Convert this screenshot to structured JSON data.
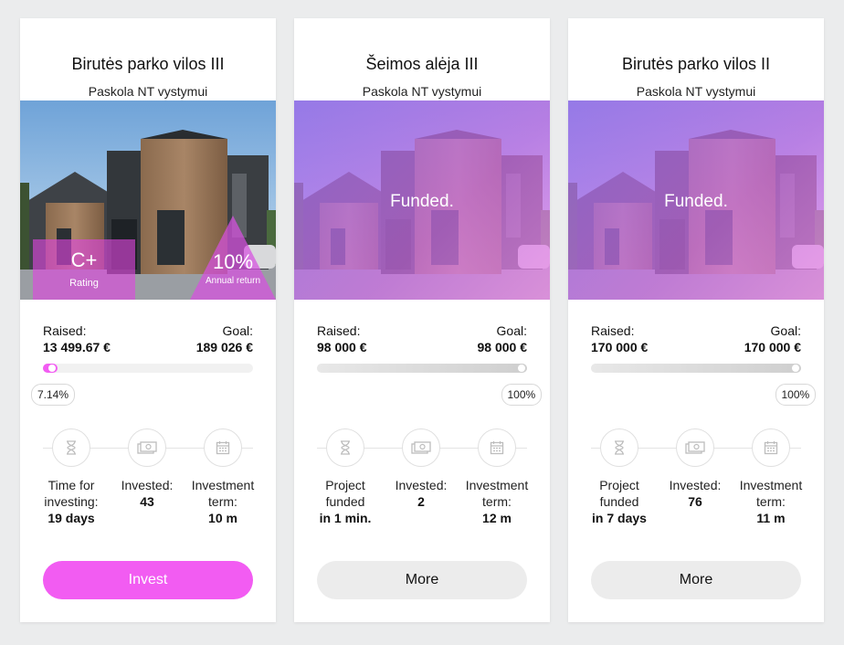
{
  "colors": {
    "accent": "#f25cf2",
    "funded_overlay": "#b97ae8",
    "button_grey": "#ececec",
    "page_bg": "#ebeced"
  },
  "cards": [
    {
      "title": "Birutės parko vilos III",
      "subtitle": "Paskola NT vystymui",
      "rating_value": "C+",
      "rating_label": "Rating",
      "return_value": "10%",
      "return_label": "Annual return",
      "raised_label": "Raised:",
      "raised_value": "13 499.67 €",
      "goal_label": "Goal:",
      "goal_value": "189 026 €",
      "progress_percent": 7.14,
      "progress_label": "7.14%",
      "stat1_line1": "Time for",
      "stat1_line2": "investing:",
      "stat1_value": "19 days",
      "stat2_label": "Invested:",
      "stat2_value": "43",
      "stat3_line1": "Investment",
      "stat3_line2": "term:",
      "stat3_value": "10 m",
      "button_label": "Invest"
    },
    {
      "title": "Šeimos alėja III",
      "subtitle": "Paskola NT vystymui",
      "funded_text": "Funded.",
      "raised_label": "Raised:",
      "raised_value": "98 000 €",
      "goal_label": "Goal:",
      "goal_value": "98 000 €",
      "progress_percent": 100,
      "progress_label": "100%",
      "stat1_line1": "Project",
      "stat1_line2": "funded",
      "stat1_value": "in 1 min.",
      "stat2_label": "Invested:",
      "stat2_value": "2",
      "stat3_line1": "Investment",
      "stat3_line2": "term:",
      "stat3_value": "12 m",
      "button_label": "More"
    },
    {
      "title": "Birutės parko vilos II",
      "subtitle": "Paskola NT vystymui",
      "funded_text": "Funded.",
      "raised_label": "Raised:",
      "raised_value": "170 000 €",
      "goal_label": "Goal:",
      "goal_value": "170 000 €",
      "progress_percent": 100,
      "progress_label": "100%",
      "stat1_line1": "Project",
      "stat1_line2": "funded",
      "stat1_value": "in 7 days",
      "stat2_label": "Invested:",
      "stat2_value": "76",
      "stat3_line1": "Investment",
      "stat3_line2": "term:",
      "stat3_value": "11 m",
      "button_label": "More"
    }
  ]
}
